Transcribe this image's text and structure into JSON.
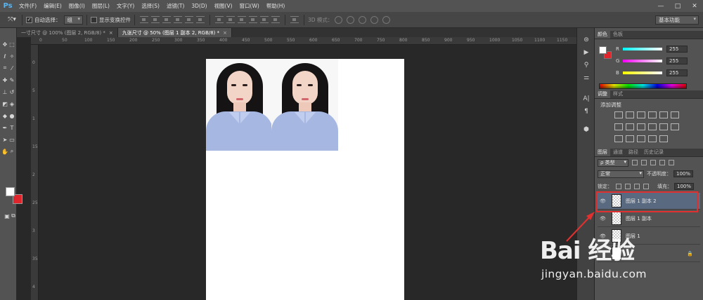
{
  "app": {
    "logo": "Ps",
    "menu": [
      "文件(F)",
      "编辑(E)",
      "图像(I)",
      "图层(L)",
      "文字(Y)",
      "选择(S)",
      "滤镜(T)",
      "3D(D)",
      "视图(V)",
      "窗口(W)",
      "帮助(H)"
    ],
    "window_controls": [
      "—",
      "□",
      "✕"
    ]
  },
  "options": {
    "auto_select_label": "自动选择：",
    "auto_select_value": "组",
    "show_transform_label": "显示变换控件",
    "mode3d_label": "3D 模式：",
    "workspace": "基本功能",
    "check_mark": "✓"
  },
  "tabs": [
    {
      "label": "一寸尺寸 @ 100% (图层 2, RGB/8) *",
      "close": "×"
    },
    {
      "label": "九张尺寸 @ 50% (图层 1 副本 2, RGB/8) *",
      "close": "×"
    }
  ],
  "ruler": {
    "top": [
      "0",
      "50",
      "100",
      "150",
      "200",
      "250",
      "300",
      "350",
      "400",
      "450",
      "500",
      "550",
      "600",
      "650",
      "700",
      "750",
      "800",
      "850",
      "900",
      "950",
      "1000",
      "1050",
      "1100",
      "1150"
    ],
    "left": [
      "0",
      "5",
      "1",
      "1\n5",
      "2",
      "2\n5",
      "3",
      "3\n5",
      "4"
    ]
  },
  "color_panel": {
    "tabs": [
      "颜色",
      "色板"
    ],
    "channels": [
      {
        "label": "R",
        "value": "255",
        "gradient": "linear-gradient(to right,#000,#ff0000)"
      },
      {
        "label": "G",
        "value": "255",
        "gradient": "linear-gradient(to right,#ff00ff,#ffffff)"
      },
      {
        "label": "B",
        "value": "255",
        "gradient": "linear-gradient(to right,#ffff00,#ffffff)"
      }
    ]
  },
  "adjust_panel": {
    "tabs": [
      "调整",
      "样式"
    ],
    "title": "添加调整"
  },
  "layers_panel": {
    "tabs": [
      "图层",
      "通道",
      "路径",
      "历史记录"
    ],
    "filter_label": "ρ 类型",
    "blend_mode": "正常",
    "opacity_label": "不透明度：",
    "opacity_value": "100%",
    "lock_label": "锁定：",
    "fill_label": "填充：",
    "fill_value": "100%",
    "layers": [
      {
        "name": "图层 1 副本 2",
        "selected": true
      },
      {
        "name": "图层 1 副本",
        "selected": false
      },
      {
        "name": "图层 1",
        "selected": false
      }
    ]
  },
  "watermark": {
    "logo": "Bai 经验",
    "url": "jingyan.baidu.com"
  },
  "colors": {
    "accent_red": "#e03030",
    "selected_layer": "#596a80",
    "panel_bg": "#535353"
  }
}
